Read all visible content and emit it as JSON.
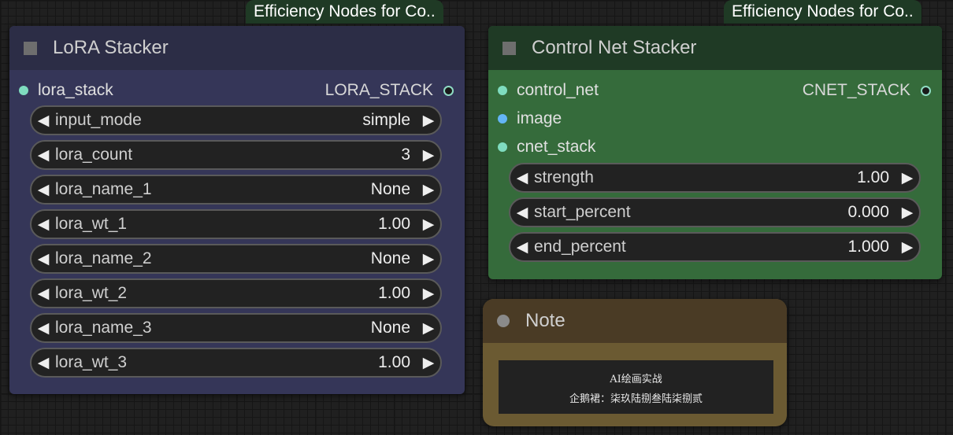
{
  "lora_node": {
    "badge": "Efficiency Nodes for Co..",
    "title": "LoRA Stacker",
    "input_label": "lora_stack",
    "output_label": "LORA_STACK",
    "widgets": [
      {
        "label": "input_mode",
        "value": "simple"
      },
      {
        "label": "lora_count",
        "value": "3"
      },
      {
        "label": "lora_name_1",
        "value": "None"
      },
      {
        "label": "lora_wt_1",
        "value": "1.00"
      },
      {
        "label": "lora_name_2",
        "value": "None"
      },
      {
        "label": "lora_wt_2",
        "value": "1.00"
      },
      {
        "label": "lora_name_3",
        "value": "None"
      },
      {
        "label": "lora_wt_3",
        "value": "1.00"
      }
    ]
  },
  "cnet_node": {
    "badge": "Efficiency Nodes for Co..",
    "title": "Control Net Stacker",
    "inputs": [
      {
        "label": "control_net",
        "color": "#7fdcbf"
      },
      {
        "label": "image",
        "color": "#64b5f6"
      },
      {
        "label": "cnet_stack",
        "color": "#7fdcbf"
      }
    ],
    "output_label": "CNET_STACK",
    "widgets": [
      {
        "label": "strength",
        "value": "1.00"
      },
      {
        "label": "start_percent",
        "value": "0.000"
      },
      {
        "label": "end_percent",
        "value": "1.000"
      }
    ]
  },
  "note_node": {
    "title": "Note",
    "lines": [
      "AI绘画实战",
      "企鹅裙：柒玖陆捌叁陆柒捌贰"
    ]
  },
  "icons": {
    "left_arrow": "◀",
    "right_arrow": "▶"
  },
  "colors": {
    "lora_body": "#353658",
    "lora_header": "#2c2d46",
    "cnet_body": "#356b3b",
    "cnet_header": "#1f3a25",
    "note_body": "#6b5a32",
    "note_header": "#4a3b25",
    "slot_teal": "#7fdcbf",
    "slot_blue": "#64b5f6"
  }
}
